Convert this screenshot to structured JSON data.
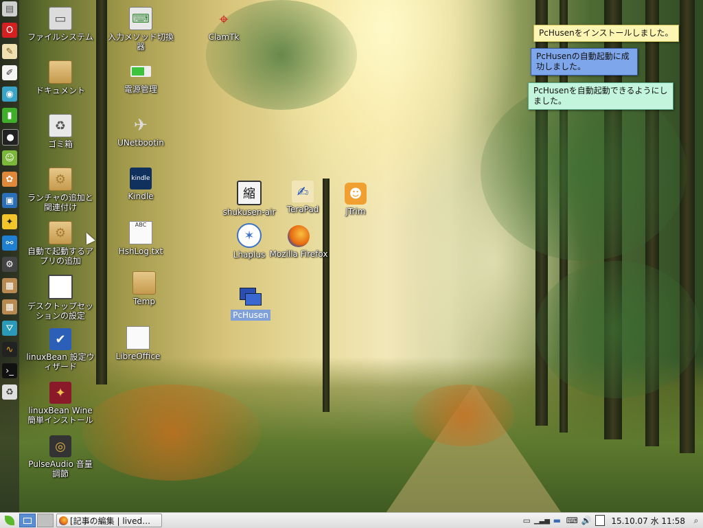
{
  "desktop_icons": [
    {
      "id": "filesystem",
      "label": "ファイルシステム",
      "icon": "drive-icon"
    },
    {
      "id": "documents",
      "label": "ドキュメント",
      "icon": "folder-icon"
    },
    {
      "id": "trash",
      "label": "ゴミ箱",
      "icon": "trash-icon"
    },
    {
      "id": "launcher",
      "label": "ランチャの追加と関連付け",
      "icon": "folder-gear-icon"
    },
    {
      "id": "autostart",
      "label": "自動で起動するアプリの追加",
      "icon": "folder-gear-icon"
    },
    {
      "id": "session",
      "label": "デスクトップセッションの設定",
      "icon": "window-icon"
    },
    {
      "id": "setup_wizard",
      "label": "linuxBean 設定ウィザード",
      "icon": "checkbox-icon"
    },
    {
      "id": "wine",
      "label": "linuxBean Wine簡単インストール",
      "icon": "wine-icon"
    },
    {
      "id": "pulseaudio",
      "label": "PulseAudio 音量調節",
      "icon": "speaker-icon"
    },
    {
      "id": "input_method",
      "label": "入力メソッド切換器",
      "icon": "keyboard-icon"
    },
    {
      "id": "power",
      "label": "電源管理",
      "icon": "battery-icon"
    },
    {
      "id": "unetbootin",
      "label": "UNetbootin",
      "icon": "unetbootin-icon"
    },
    {
      "id": "kindle",
      "label": "Kindle",
      "icon": "kindle-icon"
    },
    {
      "id": "hshlog",
      "label": "HshLog.txt",
      "icon": "text-file-icon"
    },
    {
      "id": "temp",
      "label": "Temp",
      "icon": "folder-icon"
    },
    {
      "id": "libreoffice",
      "label": "LibreOffice",
      "icon": "document-icon"
    },
    {
      "id": "clamtk",
      "label": "ClamTk",
      "icon": "target-icon"
    },
    {
      "id": "shukusen",
      "label": "shukusen-air",
      "icon": "shuku-icon"
    },
    {
      "id": "terapad",
      "label": "TeraPad",
      "icon": "pen-icon"
    },
    {
      "id": "jtrim",
      "label": "JTrim",
      "icon": "smile-icon"
    },
    {
      "id": "lhaplus",
      "label": "Lhaplus",
      "icon": "arrow-icon"
    },
    {
      "id": "firefox",
      "label": "Mozilla Firefox",
      "icon": "firefox-icon"
    },
    {
      "id": "pchusen",
      "label": "PcHusen",
      "icon": "window-stack-icon"
    }
  ],
  "notifications": [
    {
      "text": "PcHusenをインストールしました。",
      "color": "#fdf6b2"
    },
    {
      "text": "PcHusenの自動起動に成功しました。",
      "color": "#7ea6ea"
    },
    {
      "text": "PcHusenを自動起動できるようにしました。",
      "color": "#c2f5dc"
    }
  ],
  "dock": [
    "files-icon",
    "opera-icon",
    "notes-icon",
    "editor-icon",
    "people-icon",
    "green-app-icon",
    "camera-icon",
    "android-icon",
    "paint-icon",
    "image-viewer-icon",
    "chat-icon",
    "network-icon",
    "gear-icon",
    "package-icon",
    "package-icon",
    "install-icon",
    "monitor-icon",
    "terminal-icon",
    "trash-icon"
  ],
  "taskbar": {
    "menu_icon": "leaf-menu-icon",
    "task_label": "[記事の編集 | lived…",
    "datetime": "15.10.07 水 11:58",
    "tray_icons": [
      "battery-icon",
      "signal-icon",
      "removable-drive-icon",
      "keyboard-icon",
      "volume-icon",
      "clipboard-icon"
    ]
  },
  "colors": {
    "taskbar": "#e6e6e6",
    "selection": "#7fa0d8"
  }
}
